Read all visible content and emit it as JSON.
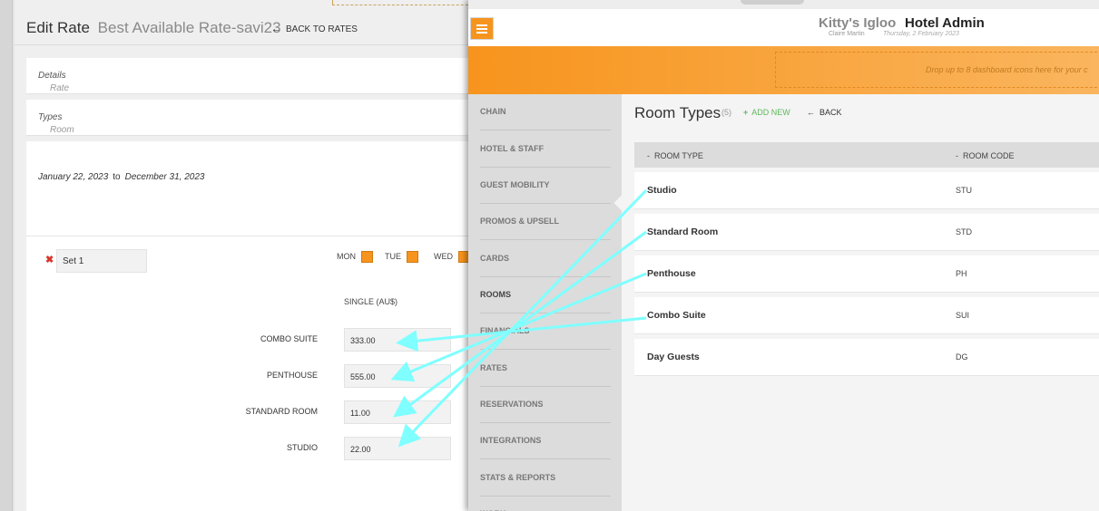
{
  "edit_rate": {
    "title": "Edit Rate",
    "subtitle": "Best Available Rate-savi23",
    "back_link": "BACK TO RATES",
    "sections": [
      {
        "em": "Rate",
        "label": "Details"
      },
      {
        "em": "Room",
        "label": "Types"
      }
    ],
    "date_from": "January 22, 2023",
    "date_to_word": "to",
    "date_to": "December 31, 2023",
    "set_name": "Set 1",
    "days": [
      "MON",
      "TUE",
      "WED"
    ],
    "column_header": "SINGLE (AU$)",
    "rates": [
      {
        "label": "COMBO SUITE",
        "value": "333.00"
      },
      {
        "label": "PENTHOUSE",
        "value": "555.00"
      },
      {
        "label": "STANDARD ROOM",
        "value": "11.00"
      },
      {
        "label": "STUDIO",
        "value": "22.00"
      }
    ]
  },
  "hotel_admin": {
    "brand": "Kitty's Igloo",
    "title": "Hotel Admin",
    "user": "Claire Martin",
    "date": "Thursday, 2 February 2023",
    "dropzone_text": "Drop up to 8 dashboard icons here for your c",
    "nav": [
      "CHAIN",
      "HOTEL & STAFF",
      "GUEST MOBILITY",
      "PROMOS & UPSELL",
      "CARDS",
      "ROOMS",
      "FINANCIALS",
      "RATES",
      "RESERVATIONS",
      "INTEGRATIONS",
      "STATS & REPORTS",
      "WORK"
    ],
    "active_nav": "ROOMS",
    "page_title": "Room Types",
    "count": "(5)",
    "add_new": "ADD NEW",
    "back": "BACK",
    "columns": [
      "ROOM TYPE",
      "ROOM CODE"
    ],
    "rows": [
      {
        "name": "Studio",
        "code": "STU"
      },
      {
        "name": "Standard Room",
        "code": "STD"
      },
      {
        "name": "Penthouse",
        "code": "PH"
      },
      {
        "name": "Combo Suite",
        "code": "SUI"
      },
      {
        "name": "Day Guests",
        "code": "DG"
      }
    ]
  },
  "colors": {
    "accent_orange": "#f7941d",
    "arrow_cyan": "#7fffff",
    "add_green": "#5cb85c",
    "remove_red": "#d9342b"
  }
}
